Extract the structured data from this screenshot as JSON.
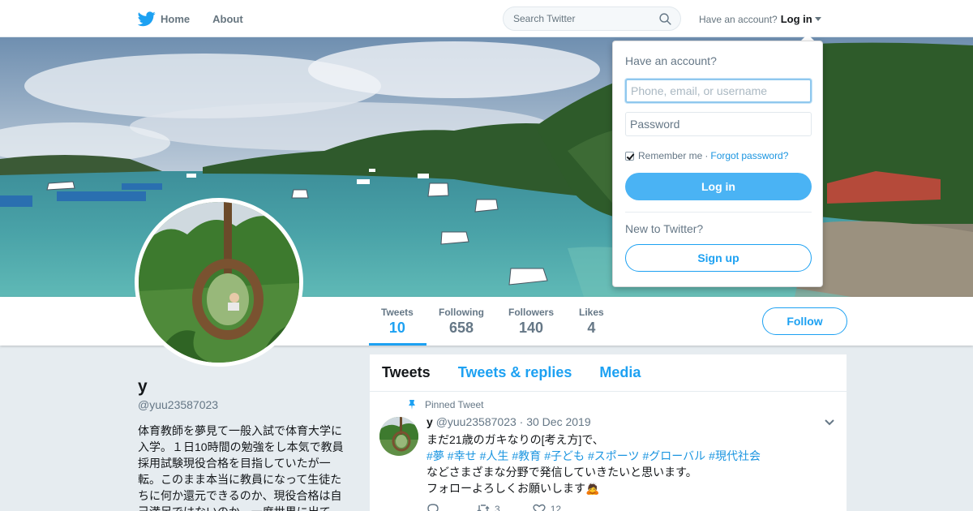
{
  "nav": {
    "home_label": "Home",
    "about_label": "About",
    "search_placeholder": "Search Twitter",
    "account_prompt": "Have an account?",
    "login_label": "Log in"
  },
  "profile": {
    "name": "y",
    "handle": "@yuu23587023",
    "bio": "体育教師を夢見て一般入試で体育大学に入学。１日10時間の勉強をし本気で教員採用試験現役合格を目指していたが一転。このまま本当に教員になって生徒たちに何か還元できるのか、現役合格は自己満足ではないのか。一度世界に出て"
  },
  "stats": [
    {
      "label": "Tweets",
      "value": "10"
    },
    {
      "label": "Following",
      "value": "658"
    },
    {
      "label": "Followers",
      "value": "140"
    },
    {
      "label": "Likes",
      "value": "4"
    }
  ],
  "follow_label": "Follow",
  "tabs": [
    {
      "label": "Tweets"
    },
    {
      "label": "Tweets & replies"
    },
    {
      "label": "Media"
    }
  ],
  "tweet": {
    "pinned_label": "Pinned Tweet",
    "author": "y",
    "handle": "@yuu23587023",
    "separator": "·",
    "date": "30 Dec 2019",
    "line1": "まだ21歳のガキなりの[考え方]で、",
    "hashtags": [
      "#夢",
      "#幸せ",
      "#人生",
      "#教育",
      "#子ども",
      "#スポーツ",
      "#グローバル",
      "#現代社会"
    ],
    "line3": "などさまざまな分野で発信していきたいと思います。",
    "line4": "フォローよろしくお願いします🙇",
    "reply_count": "",
    "retweet_count": "3",
    "like_count": "12"
  },
  "login_dropdown": {
    "title": "Have an account?",
    "username_placeholder": "Phone, email, or username",
    "password_placeholder": "Password",
    "remember_label": "Remember me",
    "separator": "·",
    "forgot_label": "Forgot password?",
    "login_button": "Log in",
    "new_prompt": "New to Twitter?",
    "signup_button": "Sign up"
  },
  "colors": {
    "accent": "#1da1f2",
    "login_button": "#4ab3f4",
    "background": "#e6ecf0"
  },
  "icons": [
    "twitter-bird-icon",
    "home-icon",
    "search-icon",
    "caret-down-icon",
    "pin-icon",
    "chevron-down-icon",
    "reply-icon",
    "retweet-icon",
    "like-icon"
  ]
}
